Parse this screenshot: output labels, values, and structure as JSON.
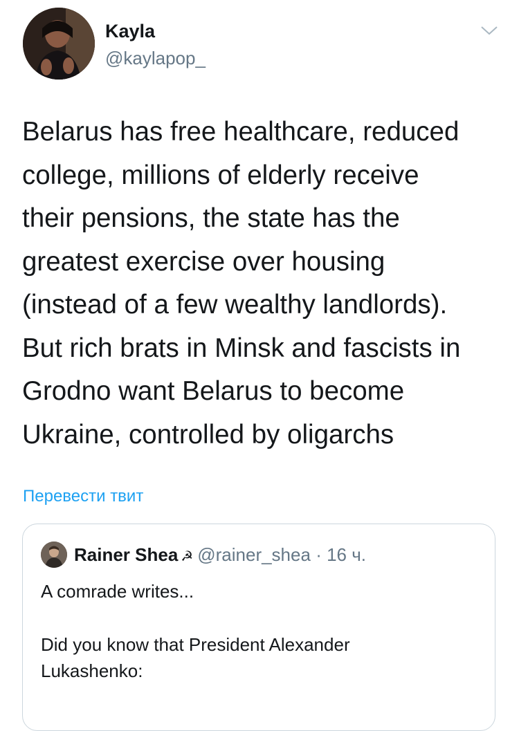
{
  "author": {
    "name": "Kayla",
    "handle": "@kaylapop_"
  },
  "tweet": {
    "text": "Belarus has free healthcare, reduced\ncollege, millions of elderly receive\ntheir pensions, the state has the\ngreatest exercise over housing\n(instead of a few wealthy landlords).\nBut rich brats in Minsk and fascists in\nGrodno want Belarus to become\nUkraine, controlled by oligarchs"
  },
  "translate_label": "Перевести твит",
  "quoted_tweet": {
    "name": "Rainer Shea",
    "emoji": "☭",
    "handle": "@rainer_shea",
    "separator": "·",
    "time": "16 ч.",
    "line1": "A comrade writes...",
    "line2": "Did you know that President Alexander",
    "line3": "Lukashenko:"
  },
  "icons": {
    "menu": "chevron-down-icon"
  },
  "colors": {
    "text": "#14171a",
    "secondary": "#657786",
    "link": "#1da1f2",
    "border": "#ccd6dd"
  }
}
